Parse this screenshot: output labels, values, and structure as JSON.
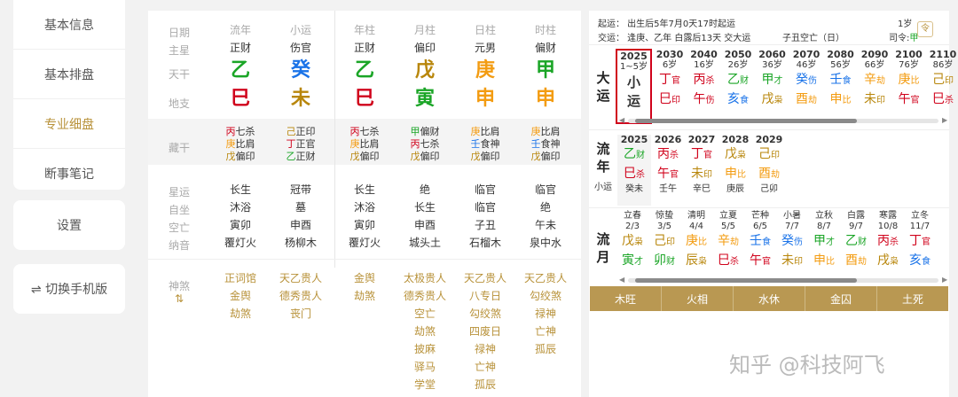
{
  "sidebar": {
    "items": [
      "基本信息",
      "基本排盘",
      "专业细盘",
      "断事笔记"
    ],
    "settings": "设置",
    "switch_mobile": "⇌ 切换手机版"
  },
  "bazi": {
    "row_labels": {
      "date": "日期",
      "main_star": "主星",
      "tiangan": "天干",
      "dizhi": "地支",
      "canggan": "藏干",
      "xingyun": "星运",
      "zizuo": "自坐",
      "kongwang": "空亡",
      "nayin": "纳音",
      "shensha": "神煞"
    },
    "columns": [
      {
        "date": "流年",
        "main_star": "正财",
        "gan": "乙",
        "gan_color": "#1aa526",
        "zhi": "巳",
        "zhi_color": "#d0021b",
        "hidden": [
          {
            "c": "丙",
            "cc": "#d0021b",
            "t": "七杀"
          },
          {
            "c": "庚",
            "cc": "#f39c12",
            "t": "比肩"
          },
          {
            "c": "戊",
            "cc": "#b8860b",
            "t": "偏印"
          }
        ],
        "xingyun": "长生",
        "zizuo": "沐浴",
        "kongwang": "寅卯",
        "nayin": "覆灯火",
        "shensha": [
          "正词馆",
          "金舆",
          "劫煞"
        ]
      },
      {
        "date": "小运",
        "main_star": "伤官",
        "gan": "癸",
        "gan_color": "#1a73e8",
        "zhi": "未",
        "zhi_color": "#b8860b",
        "hidden": [
          {
            "c": "己",
            "cc": "#b8860b",
            "t": "正印"
          },
          {
            "c": "丁",
            "cc": "#d0021b",
            "t": "正官"
          },
          {
            "c": "乙",
            "cc": "#1aa526",
            "t": "正财"
          }
        ],
        "xingyun": "冠带",
        "zizuo": "墓",
        "kongwang": "申酉",
        "nayin": "杨柳木",
        "shensha": [
          "天乙贵人",
          "德秀贵人",
          "丧门"
        ]
      },
      {
        "date": "年柱",
        "main_star": "正财",
        "gan": "乙",
        "gan_color": "#1aa526",
        "zhi": "巳",
        "zhi_color": "#d0021b",
        "hidden": [
          {
            "c": "丙",
            "cc": "#d0021b",
            "t": "七杀"
          },
          {
            "c": "庚",
            "cc": "#f39c12",
            "t": "比肩"
          },
          {
            "c": "戊",
            "cc": "#b8860b",
            "t": "偏印"
          }
        ],
        "xingyun": "长生",
        "zizuo": "沐浴",
        "kongwang": "寅卯",
        "nayin": "覆灯火",
        "shensha": [
          "金舆",
          "劫煞"
        ]
      },
      {
        "date": "月柱",
        "main_star": "偏印",
        "gan": "戊",
        "gan_color": "#b8860b",
        "zhi": "寅",
        "zhi_color": "#1aa526",
        "hidden": [
          {
            "c": "甲",
            "cc": "#1aa526",
            "t": "偏财"
          },
          {
            "c": "丙",
            "cc": "#d0021b",
            "t": "七杀"
          },
          {
            "c": "戊",
            "cc": "#b8860b",
            "t": "偏印"
          }
        ],
        "xingyun": "绝",
        "zizuo": "长生",
        "kongwang": "申酉",
        "nayin": "城头土",
        "shensha": [
          "太极贵人",
          "德秀贵人",
          "空亡",
          "劫煞",
          "披麻",
          "驿马",
          "学堂"
        ]
      },
      {
        "date": "日柱",
        "main_star": "元男",
        "gan": "庚",
        "gan_color": "#f39c12",
        "zhi": "申",
        "zhi_color": "#f39c12",
        "hidden": [
          {
            "c": "庚",
            "cc": "#f39c12",
            "t": "比肩"
          },
          {
            "c": "壬",
            "cc": "#1a73e8",
            "t": "食神"
          },
          {
            "c": "戊",
            "cc": "#b8860b",
            "t": "偏印"
          }
        ],
        "xingyun": "临官",
        "zizuo": "临官",
        "kongwang": "子丑",
        "nayin": "石榴木",
        "shensha": [
          "天乙贵人",
          "八专日",
          "勾绞煞",
          "四废日",
          "禄神",
          "亡神",
          "孤辰"
        ]
      },
      {
        "date": "时柱",
        "main_star": "偏财",
        "gan": "甲",
        "gan_color": "#1aa526",
        "zhi": "申",
        "zhi_color": "#f39c12",
        "hidden": [
          {
            "c": "庚",
            "cc": "#f39c12",
            "t": "比肩"
          },
          {
            "c": "壬",
            "cc": "#1a73e8",
            "t": "食神"
          },
          {
            "c": "戊",
            "cc": "#b8860b",
            "t": "偏印"
          }
        ],
        "xingyun": "临官",
        "zizuo": "绝",
        "kongwang": "午未",
        "nayin": "泉中水",
        "shensha": [
          "天乙贵人",
          "勾绞煞",
          "禄神",
          "亡神",
          "孤辰"
        ]
      }
    ]
  },
  "dayun": {
    "qiyun": "起运：  出生后5年7月0天17时起运",
    "jiaoyun": "交运：  逢庚、乙年 白露后13天 交大运",
    "kongwang": "子丑空亡（日）",
    "age": "1岁",
    "siling_label": "司令:",
    "siling_value": "甲",
    "dayun_label": "大运",
    "xiaoyun_label": "小运",
    "liunian_label": "流年",
    "liuyue_label": "流月",
    "current": {
      "year": "2025",
      "age": "1~5岁",
      "l1": "小",
      "l2": "运"
    },
    "columns": [
      {
        "year": "2030",
        "age": "6岁",
        "g": "丁",
        "gc": "#d0021b",
        "gt": "官",
        "zh": "巳",
        "zc": "#d0021b",
        "zt": "印"
      },
      {
        "year": "2040",
        "age": "16岁",
        "g": "丙",
        "gc": "#d0021b",
        "gt": "杀",
        "zh": "午",
        "zc": "#d0021b",
        "zt": "伤"
      },
      {
        "year": "2050",
        "age": "26岁",
        "g": "乙",
        "gc": "#1aa526",
        "gt": "财",
        "zh": "亥",
        "zc": "#1a73e8",
        "zt": "食"
      },
      {
        "year": "2060",
        "age": "36岁",
        "g": "甲",
        "gc": "#1aa526",
        "gt": "才",
        "zh": "戌",
        "zc": "#b8860b",
        "zt": "枭"
      },
      {
        "year": "2070",
        "age": "46岁",
        "g": "癸",
        "gc": "#1a73e8",
        "gt": "伤",
        "zh": "酉",
        "zc": "#f39c12",
        "zt": "劫"
      },
      {
        "year": "2080",
        "age": "56岁",
        "g": "壬",
        "gc": "#1a73e8",
        "gt": "食",
        "zh": "申",
        "zc": "#f39c12",
        "zt": "比"
      },
      {
        "year": "2090",
        "age": "66岁",
        "g": "辛",
        "gc": "#f39c12",
        "gt": "劫",
        "zh": "未",
        "zc": "#b8860b",
        "zt": "印"
      },
      {
        "year": "2100",
        "age": "76岁",
        "g": "庚",
        "gc": "#f39c12",
        "gt": "比",
        "zh": "午",
        "zc": "#d0021b",
        "zt": "官"
      },
      {
        "year": "2110",
        "age": "86岁",
        "g": "己",
        "gc": "#b8860b",
        "gt": "印",
        "zh": "巳",
        "zc": "#d0021b",
        "zt": "杀"
      }
    ],
    "liunian": [
      {
        "year": "2025",
        "g": "乙",
        "gc": "#1aa526",
        "gt": "财",
        "zh": "巳",
        "zc": "#d0021b",
        "zt": "杀",
        "sub": "癸未"
      },
      {
        "year": "2026",
        "g": "丙",
        "gc": "#d0021b",
        "gt": "杀",
        "zh": "午",
        "zc": "#d0021b",
        "zt": "官",
        "sub": "壬午"
      },
      {
        "year": "2027",
        "g": "丁",
        "gc": "#d0021b",
        "gt": "官",
        "zh": "未",
        "zc": "#b8860b",
        "zt": "印",
        "sub": "辛巳"
      },
      {
        "year": "2028",
        "g": "戊",
        "gc": "#b8860b",
        "gt": "枭",
        "zh": "申",
        "zc": "#f39c12",
        "zt": "比",
        "sub": "庚辰"
      },
      {
        "year": "2029",
        "g": "己",
        "gc": "#b8860b",
        "gt": "印",
        "zh": "酉",
        "zc": "#f39c12",
        "zt": "劫",
        "sub": "己卯"
      }
    ],
    "liuyue": [
      {
        "jq": "立春",
        "d": "2/3",
        "g": "戊",
        "gc": "#b8860b",
        "gt": "枭",
        "zh": "寅",
        "zc": "#1aa526",
        "zt": "才"
      },
      {
        "jq": "惊蛰",
        "d": "3/5",
        "g": "己",
        "gc": "#b8860b",
        "gt": "印",
        "zh": "卯",
        "zc": "#1aa526",
        "zt": "财"
      },
      {
        "jq": "清明",
        "d": "4/4",
        "g": "庚",
        "gc": "#f39c12",
        "gt": "比",
        "zh": "辰",
        "zc": "#b8860b",
        "zt": "枭"
      },
      {
        "jq": "立夏",
        "d": "5/5",
        "g": "辛",
        "gc": "#f39c12",
        "gt": "劫",
        "zh": "巳",
        "zc": "#d0021b",
        "zt": "杀"
      },
      {
        "jq": "芒种",
        "d": "6/5",
        "g": "壬",
        "gc": "#1a73e8",
        "gt": "食",
        "zh": "午",
        "zc": "#d0021b",
        "zt": "官"
      },
      {
        "jq": "小暑",
        "d": "7/7",
        "g": "癸",
        "gc": "#1a73e8",
        "gt": "伤",
        "zh": "未",
        "zc": "#b8860b",
        "zt": "印"
      },
      {
        "jq": "立秋",
        "d": "8/7",
        "g": "甲",
        "gc": "#1aa526",
        "gt": "才",
        "zh": "申",
        "zc": "#f39c12",
        "zt": "比"
      },
      {
        "jq": "白露",
        "d": "9/7",
        "g": "乙",
        "gc": "#1aa526",
        "gt": "财",
        "zh": "酉",
        "zc": "#f39c12",
        "zt": "劫"
      },
      {
        "jq": "寒露",
        "d": "10/8",
        "g": "丙",
        "gc": "#d0021b",
        "gt": "杀",
        "zh": "戌",
        "zc": "#b8860b",
        "zt": "枭"
      },
      {
        "jq": "立冬",
        "d": "11/7",
        "g": "丁",
        "gc": "#d0021b",
        "gt": "官",
        "zh": "亥",
        "zc": "#1a73e8",
        "zt": "食"
      }
    ],
    "wuxing": [
      "木旺",
      "火相",
      "水休",
      "金囚",
      "土死"
    ]
  },
  "watermark": "知乎 @科技阿飞",
  "colors": {
    "accent": "#b8923a",
    "bar": "#b99852",
    "highlight": "#d0021b"
  }
}
